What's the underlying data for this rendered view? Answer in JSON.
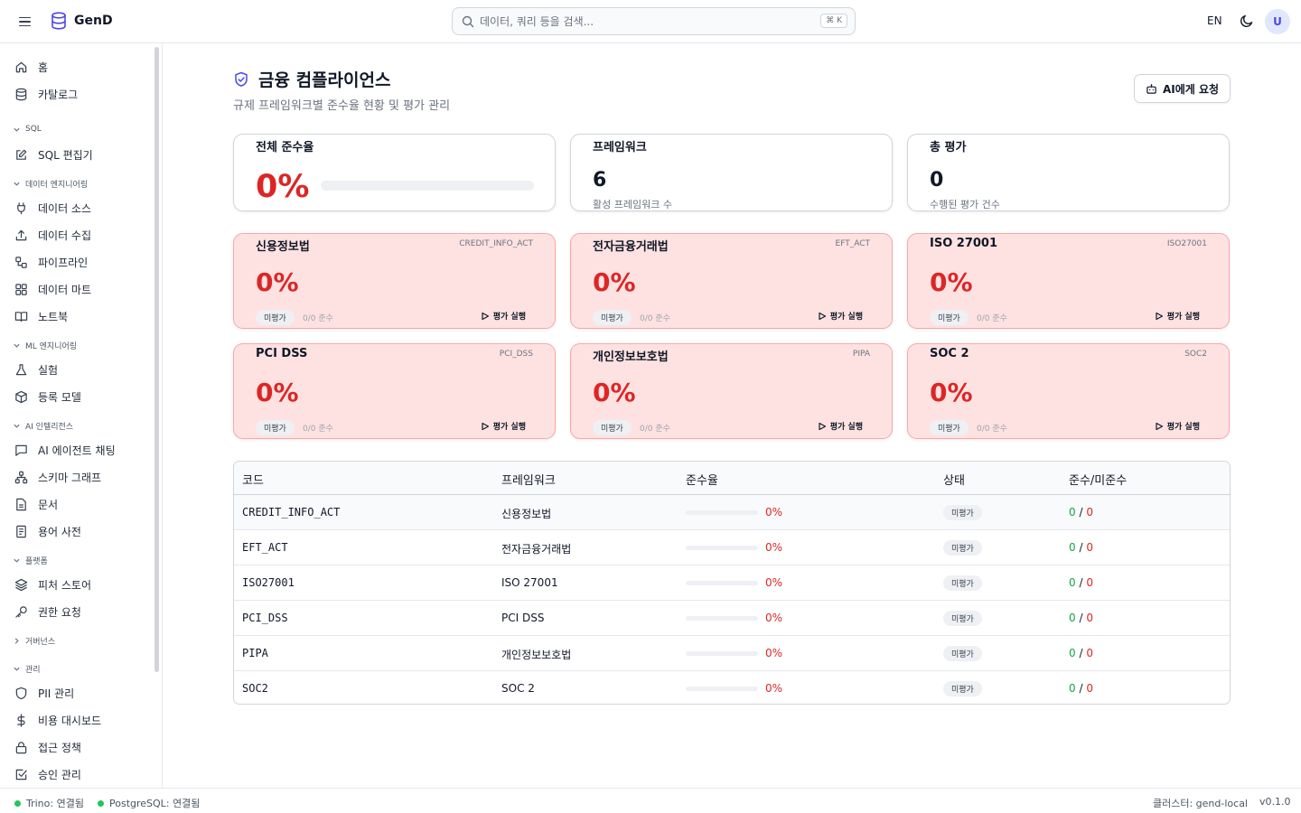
{
  "app": {
    "name": "GenD"
  },
  "search": {
    "placeholder": "데이터, 쿼리 등을 검색...",
    "shortcut": "⌘ K"
  },
  "header": {
    "lang": "EN",
    "avatar_initial": "U"
  },
  "sidebar": {
    "items_top": [
      {
        "label": "홈",
        "icon": "home-icon"
      },
      {
        "label": "카탈로그",
        "icon": "database-icon"
      }
    ],
    "sections": [
      {
        "label": "SQL",
        "items": [
          {
            "label": "SQL 편집기",
            "icon": "edit-icon"
          }
        ]
      },
      {
        "label": "데이터 엔지니어링",
        "items": [
          {
            "label": "데이터 소스",
            "icon": "plug-icon"
          },
          {
            "label": "데이터 수집",
            "icon": "upload-icon"
          },
          {
            "label": "파이프라인",
            "icon": "workflow-icon"
          },
          {
            "label": "데이터 마트",
            "icon": "grid-icon"
          },
          {
            "label": "노트북",
            "icon": "book-icon"
          }
        ]
      },
      {
        "label": "ML 엔지니어링",
        "items": [
          {
            "label": "실험",
            "icon": "flask-icon"
          },
          {
            "label": "등록 모델",
            "icon": "package-icon"
          }
        ]
      },
      {
        "label": "AI 인텔리전스",
        "items": [
          {
            "label": "AI 에이전트 채팅",
            "icon": "chat-icon"
          },
          {
            "label": "스키마 그래프",
            "icon": "network-icon"
          },
          {
            "label": "문서",
            "icon": "file-icon"
          },
          {
            "label": "용어 사전",
            "icon": "dictionary-icon"
          }
        ]
      },
      {
        "label": "플랫폼",
        "items": [
          {
            "label": "피처 스토어",
            "icon": "layers-icon"
          },
          {
            "label": "권한 요청",
            "icon": "key-icon"
          }
        ]
      },
      {
        "label": "거버넌스",
        "items": []
      },
      {
        "label": "관리",
        "items": [
          {
            "label": "PII 관리",
            "icon": "shield-icon"
          },
          {
            "label": "비용 대시보드",
            "icon": "dollar-icon"
          },
          {
            "label": "접근 정책",
            "icon": "lock-icon"
          },
          {
            "label": "승인 관리",
            "icon": "check-square-icon"
          }
        ]
      }
    ]
  },
  "page": {
    "title": "금융 컴플라이언스",
    "subtitle": "규제 프레임워크별 준수율 현황 및 평가 관리",
    "ai_button": "AI에게 요청"
  },
  "stats": {
    "overall": {
      "label": "전체 준수율",
      "value": "0%",
      "progress": 0
    },
    "frameworks": {
      "label": "프레임워크",
      "value": "6",
      "desc": "활성 프레임워크 수"
    },
    "assessments": {
      "label": "총 평가",
      "value": "0",
      "desc": "수행된 평가 건수"
    }
  },
  "frameworks": [
    {
      "name": "신용정보법",
      "code": "CREDIT_INFO_ACT",
      "pct": "0%",
      "status": "미평가",
      "count": "0/0 준수",
      "run": "평가 실행"
    },
    {
      "name": "전자금융거래법",
      "code": "EFT_ACT",
      "pct": "0%",
      "status": "미평가",
      "count": "0/0 준수",
      "run": "평가 실행"
    },
    {
      "name": "ISO 27001",
      "code": "ISO27001",
      "pct": "0%",
      "status": "미평가",
      "count": "0/0 준수",
      "run": "평가 실행"
    },
    {
      "name": "PCI DSS",
      "code": "PCI_DSS",
      "pct": "0%",
      "status": "미평가",
      "count": "0/0 준수",
      "run": "평가 실행"
    },
    {
      "name": "개인정보보호법",
      "code": "PIPA",
      "pct": "0%",
      "status": "미평가",
      "count": "0/0 준수",
      "run": "평가 실행"
    },
    {
      "name": "SOC 2",
      "code": "SOC2",
      "pct": "0%",
      "status": "미평가",
      "count": "0/0 준수",
      "run": "평가 실행"
    }
  ],
  "table": {
    "headers": [
      "코드",
      "프레임워크",
      "준수율",
      "상태",
      "준수/미준수"
    ],
    "rows": [
      {
        "code": "CREDIT_INFO_ACT",
        "name": "신용정보법",
        "pct": "0%",
        "status": "미평가",
        "ok": "0",
        "ng": "0"
      },
      {
        "code": "EFT_ACT",
        "name": "전자금융거래법",
        "pct": "0%",
        "status": "미평가",
        "ok": "0",
        "ng": "0"
      },
      {
        "code": "ISO27001",
        "name": "ISO 27001",
        "pct": "0%",
        "status": "미평가",
        "ok": "0",
        "ng": "0"
      },
      {
        "code": "PCI_DSS",
        "name": "PCI DSS",
        "pct": "0%",
        "status": "미평가",
        "ok": "0",
        "ng": "0"
      },
      {
        "code": "PIPA",
        "name": "개인정보보호법",
        "pct": "0%",
        "status": "미평가",
        "ok": "0",
        "ng": "0"
      },
      {
        "code": "SOC2",
        "name": "SOC 2",
        "pct": "0%",
        "status": "미평가",
        "ok": "0",
        "ng": "0"
      }
    ]
  },
  "statusbar": {
    "trino": "Trino: 연결됨",
    "postgres": "PostgreSQL: 연결됨",
    "cluster": "클러스터: gend-local",
    "version": "v0.1.0"
  },
  "colors": {
    "accent": "#4f46e5",
    "danger": "#dc2626",
    "success": "#16a34a",
    "danger_bg": "#fee2e2"
  }
}
